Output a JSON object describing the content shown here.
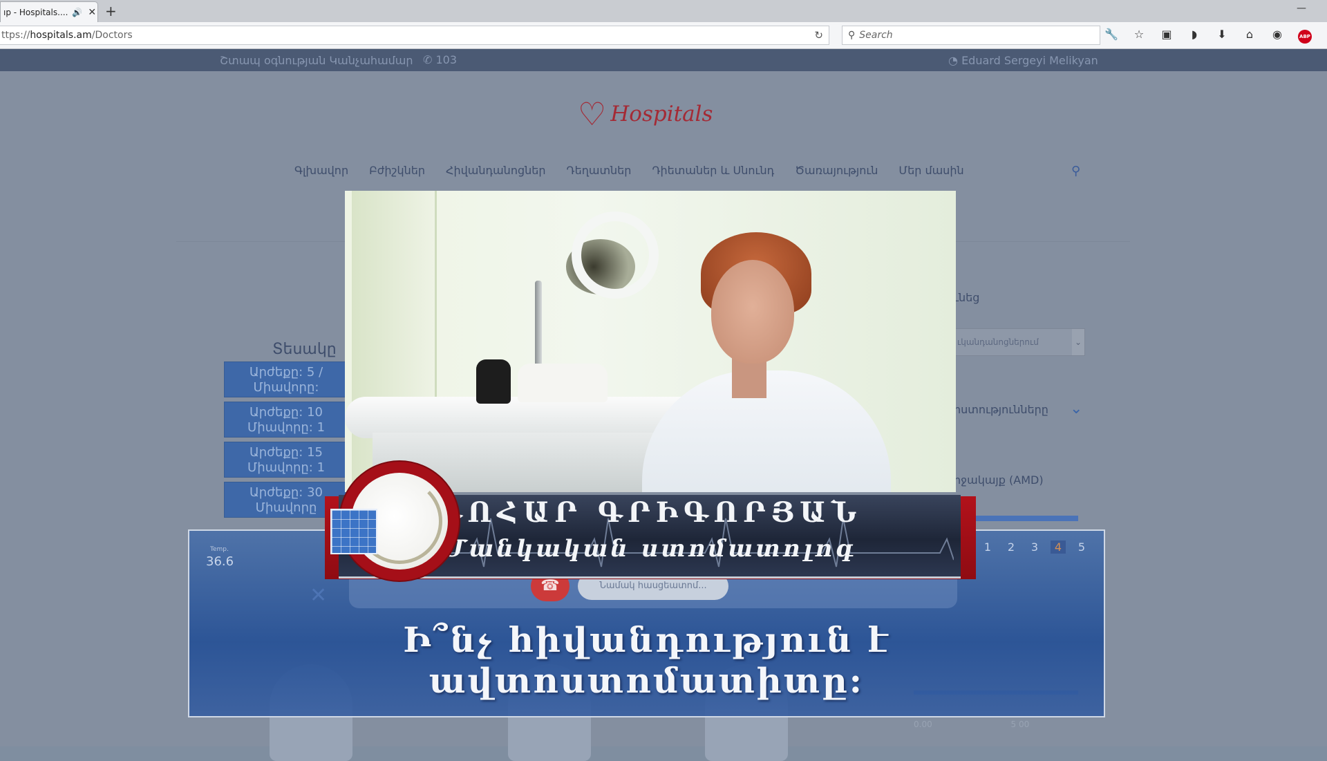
{
  "browser": {
    "tab_title": "ıp - Hospitals....",
    "tab_audio_icon": "speaker-icon",
    "url_prefix": "ttps://",
    "url_domain": "hospitals.am",
    "url_path": "/Doctors",
    "search_placeholder": "Search"
  },
  "site": {
    "emergency_text": "Շտապ օգնության Կանչահամար",
    "emergency_number": "103",
    "user_name": "Eduard Sergeyi Melikyan",
    "logo_text": "Hospitals",
    "nav": [
      "Գլխավոր",
      "Բժիշկներ",
      "Հիվանդանոցներ",
      "Դեղատներ",
      "Դիետաներ և Սնունդ",
      "Ծառայություն",
      "Մեր մասին"
    ],
    "filters_title": "Տեսակը",
    "filter_buttons": [
      {
        "line1": "Արժեքը: 5 /",
        "line2": "Միավորը:"
      },
      {
        "line1": "Արժեքը: 10",
        "line2": "Միավորը: 1"
      },
      {
        "line1": "Արժեքը: 15",
        "line2": "Միավորը: 1"
      },
      {
        "line1": "Արժեքը: 30",
        "line2": "Միավորը"
      }
    ],
    "right_panel": {
      "heading": "ւնեց",
      "select_value": "ւկանդանոցներում",
      "specialties": "իստությունները",
      "currency": "իջակայք (AMD)",
      "range_min": "0.00",
      "range_max": "5 00"
    }
  },
  "overlay": {
    "doctor_name": "ԳՈՀԱՐ ԳՐԻԳՈՐՅԱՆ",
    "doctor_title": "Մանկական ստոմատոլոգ",
    "question": "Ի՞նչ հիվանդություն է ավտոստոմատիտը:",
    "panel_small_label": "Temp.",
    "panel_temp": "36.6",
    "pill_text": "Նամակ հասցեատոմ...",
    "pager": [
      "1",
      "2",
      "3",
      "4",
      "5"
    ],
    "pager_active_index": 3
  }
}
